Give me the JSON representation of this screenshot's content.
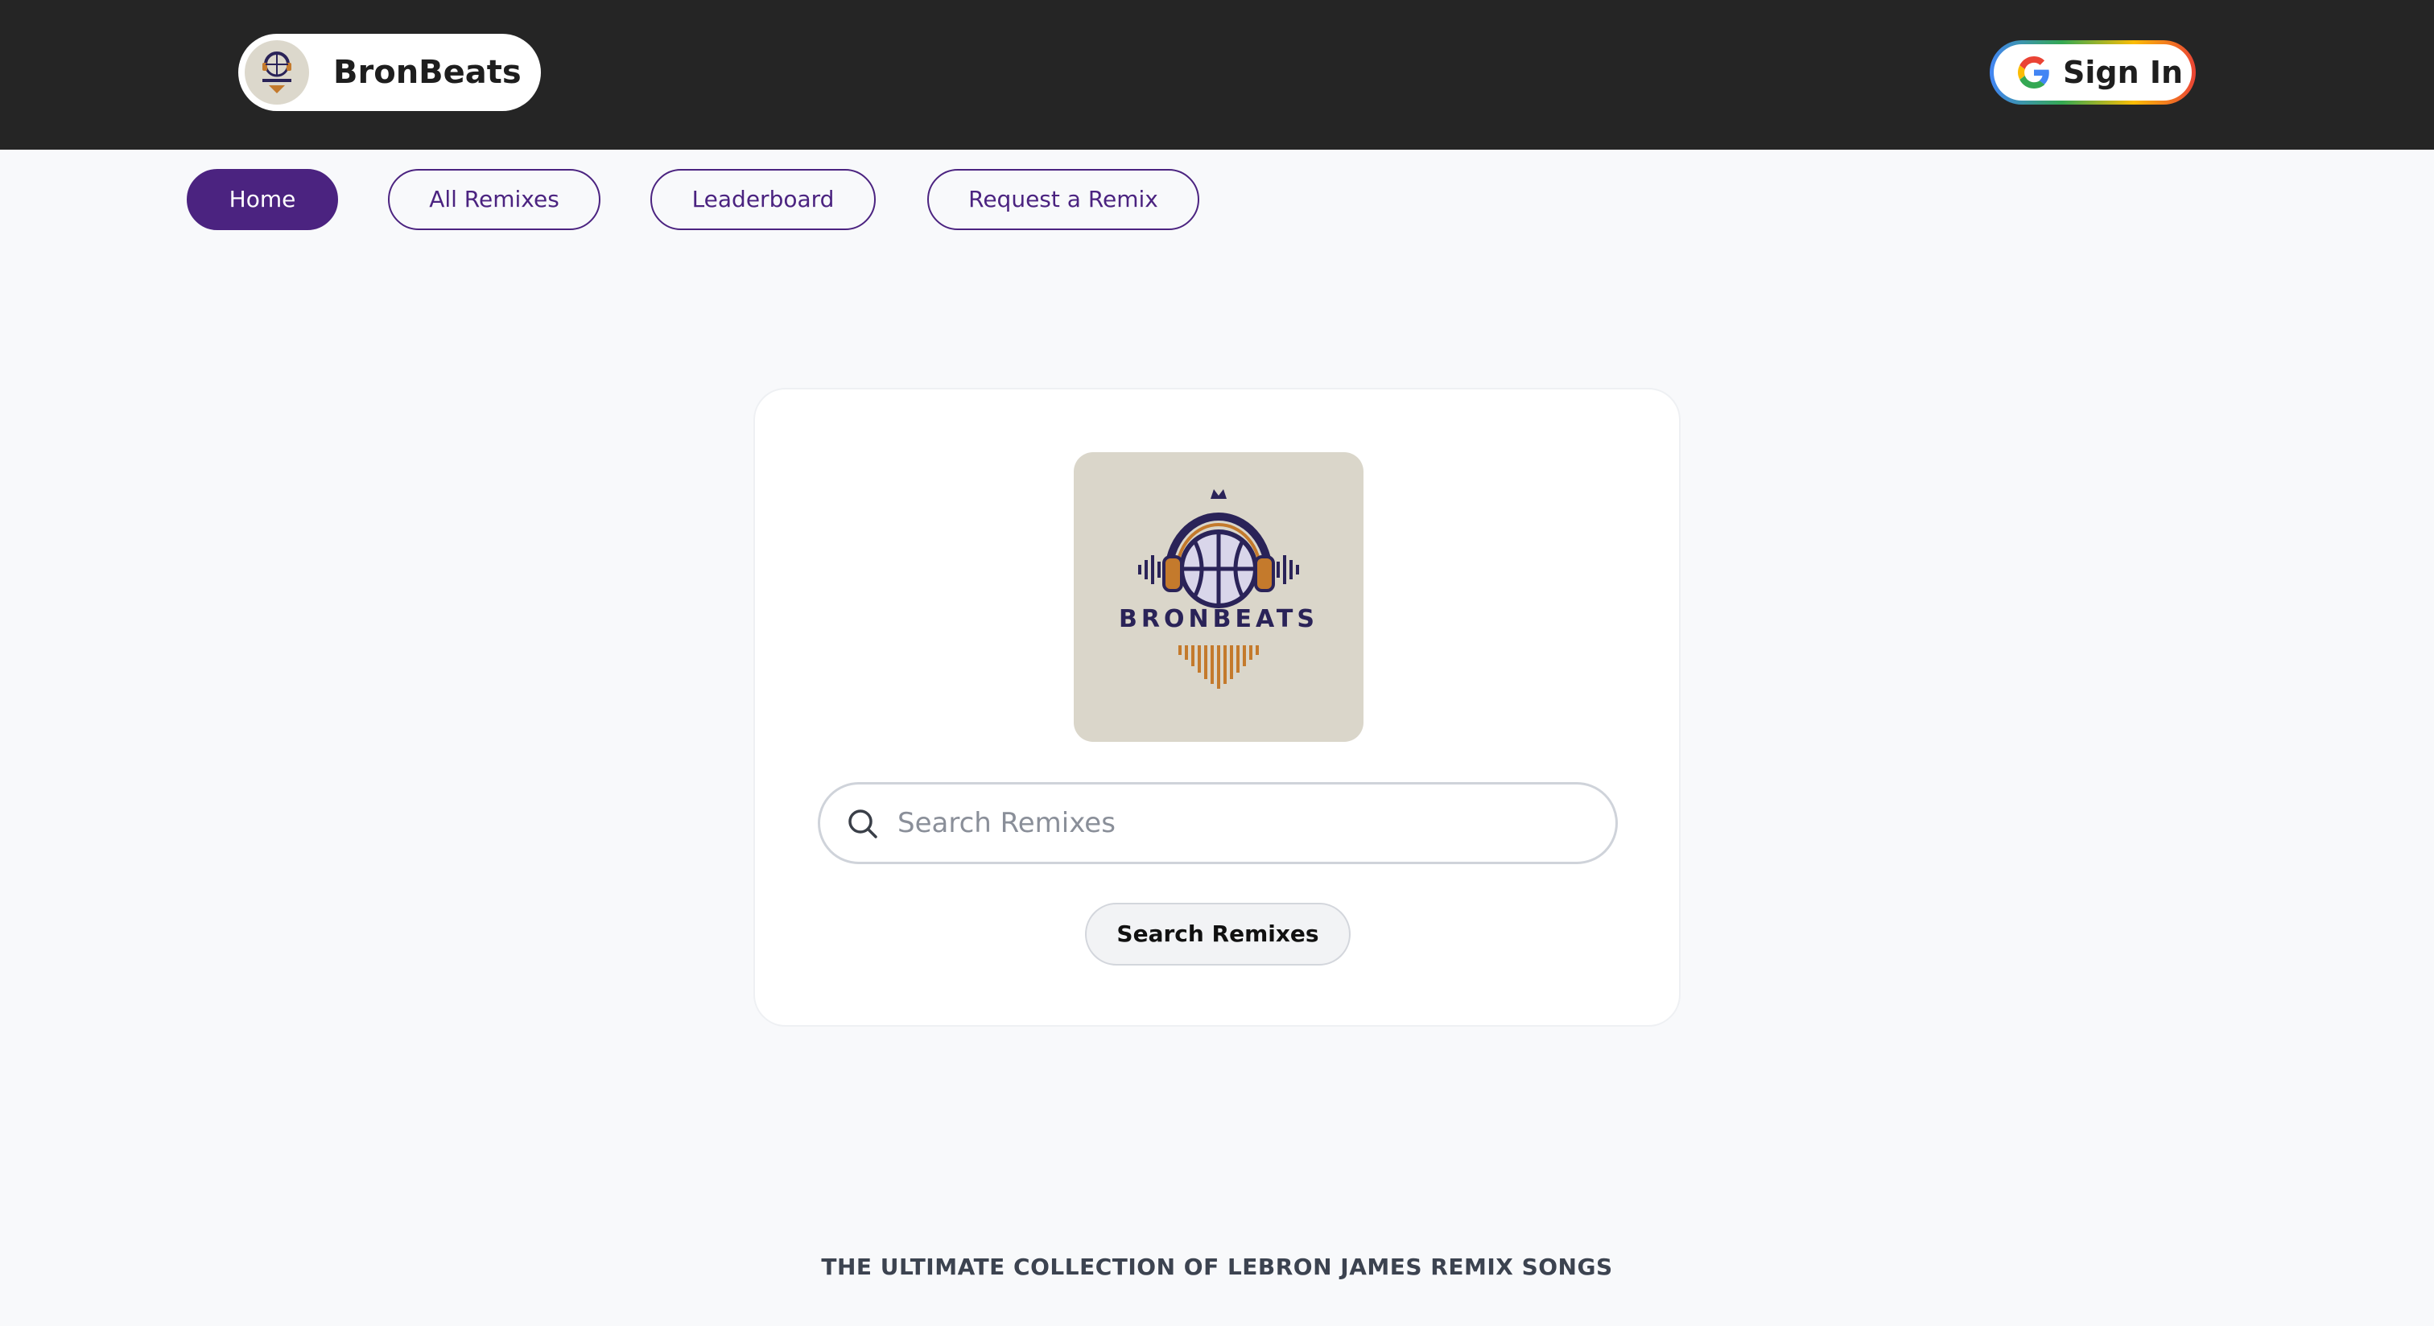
{
  "brand": {
    "name": "BronBeats",
    "logo_wordmark": "BRONBEATS"
  },
  "header": {
    "sign_in_label": "Sign In"
  },
  "nav": {
    "items": [
      {
        "label": "Home",
        "active": true
      },
      {
        "label": "All Remixes",
        "active": false
      },
      {
        "label": "Leaderboard",
        "active": false
      },
      {
        "label": "Request a Remix",
        "active": false
      }
    ]
  },
  "search": {
    "placeholder": "Search Remixes",
    "value": "",
    "button_label": "Search Remixes"
  },
  "footer": {
    "tagline": "THE ULTIMATE COLLECTION OF LEBRON JAMES REMIX SONGS"
  },
  "colors": {
    "header_bg": "#252525",
    "accent_purple": "#4b2380",
    "page_bg": "#f8f9fb",
    "logo_navy": "#2a2358",
    "logo_orange": "#c47a2c"
  },
  "icons": {
    "search": "search-icon",
    "google": "google-g-icon",
    "logo": "basketball-headphones-logo"
  }
}
